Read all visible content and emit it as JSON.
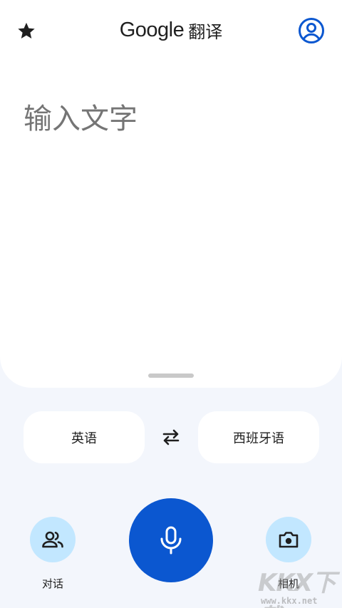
{
  "header": {
    "logo_text": "Google",
    "product_text": "翻译",
    "star_icon": "star-icon",
    "account_icon": "account-circle-icon"
  },
  "input": {
    "placeholder": "输入文字"
  },
  "languages": {
    "source": "英语",
    "target": "西班牙语",
    "swap_icon": "swap-arrows-icon"
  },
  "actions": {
    "conversation_label": "对话",
    "camera_label": "相机",
    "mic_icon": "microphone-icon",
    "conversation_icon": "people-icon",
    "camera_icon": "camera-icon"
  },
  "watermark": {
    "logo_text": "KKX下载",
    "url": "www.kkx.net"
  },
  "colors": {
    "accent": "#0b57d0",
    "tonal": "#c2e7ff",
    "background": "#f3f6fc",
    "surface": "#ffffff"
  }
}
